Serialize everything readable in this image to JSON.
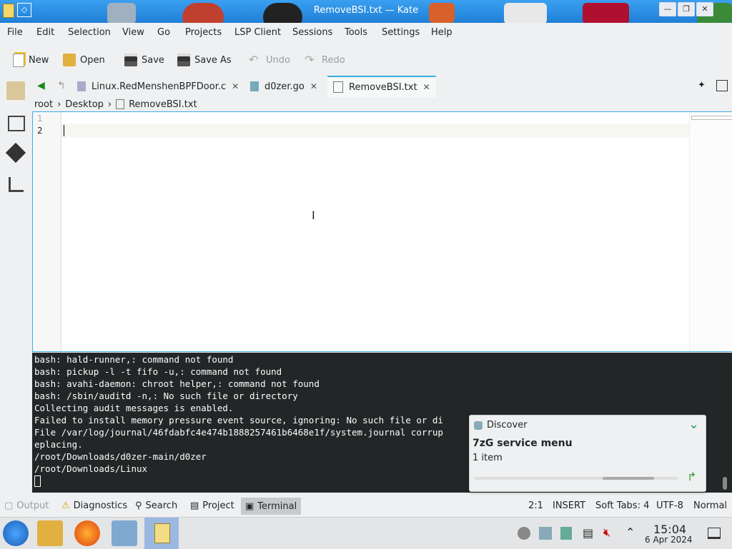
{
  "window": {
    "title": "RemoveBSI.txt — Kate"
  },
  "menu": [
    "File",
    "Edit",
    "Selection",
    "View",
    "Go",
    "Projects",
    "LSP Client",
    "Sessions",
    "Tools",
    "Settings",
    "Help"
  ],
  "toolbar": {
    "new": "New",
    "open": "Open",
    "save": "Save",
    "save_as": "Save As",
    "undo": "Undo",
    "redo": "Redo"
  },
  "tabs": [
    {
      "label": "Linux.RedMenshenBPFDoor.c"
    },
    {
      "label": "d0zer.go"
    },
    {
      "label": "RemoveBSI.txt"
    }
  ],
  "breadcrumb": [
    "root",
    "Desktop",
    "RemoveBSI.txt"
  ],
  "editor": {
    "line_numbers": [
      "1",
      "2"
    ]
  },
  "terminal": {
    "lines": [
      "bash: hald-runner,: command not found",
      "bash: pickup -l -t fifo -u,: command not found",
      "bash: avahi-daemon: chroot helper,: command not found",
      "bash: /sbin/auditd -n,: No such file or directory",
      "Collecting audit messages is enabled.",
      "Failed to install memory pressure event source, ignoring: No such file or di",
      "File /var/log/journal/46fdabfc4e474b1888257461b6468e1f/system.journal corrup",
      "eplacing.",
      "/root/Downloads/d0zer-main/d0zer",
      "/root/Downloads/Linux"
    ]
  },
  "notification": {
    "app": "Discover",
    "title": "7zG service menu",
    "subtitle": "1 item"
  },
  "statusbar": {
    "output": "Output",
    "diagnostics": "Diagnostics",
    "search": "Search",
    "project": "Project",
    "terminal": "Terminal",
    "position": "2:1",
    "mode": "INSERT",
    "tabs": "Soft Tabs: 4",
    "encoding": "UTF-8",
    "mode2": "Normal"
  },
  "clock": {
    "time": "15:04",
    "date": "6 Apr 2024"
  }
}
